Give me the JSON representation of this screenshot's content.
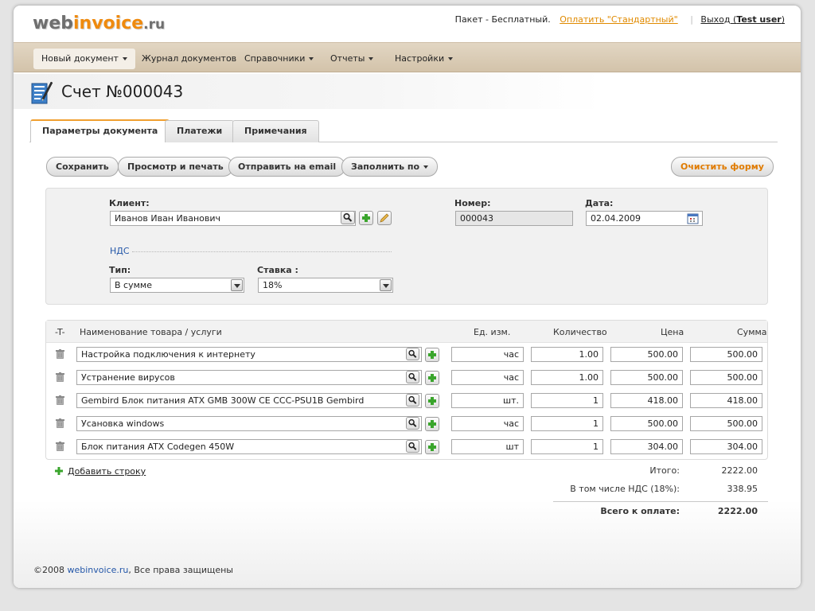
{
  "header": {
    "logo": {
      "part1": "web",
      "part2": "invoice",
      "part3": ".ru"
    },
    "plan_text": "Пакет - Бесплатный.",
    "upgrade_link": "Оплатить \"Стандартный\"",
    "logout_label": "Выход",
    "user_name": "Test user"
  },
  "menu": {
    "items": [
      {
        "label": "Новый документ"
      },
      {
        "label": "Журнал документов"
      },
      {
        "label": "Справочники"
      },
      {
        "label": "Отчеты"
      },
      {
        "label": "Настройки"
      }
    ]
  },
  "title": "Счет №000043",
  "tabs": [
    {
      "label": "Параметры документа"
    },
    {
      "label": "Платежи"
    },
    {
      "label": "Примечания"
    }
  ],
  "toolbar": {
    "save": "Сохранить",
    "preview": "Просмотр и печать",
    "email": "Отправить на email",
    "fill": "Заполнить по",
    "clear": "Очистить форму"
  },
  "form": {
    "client_label": "Клиент:",
    "client_value": "Иванов Иван Иванович",
    "number_label": "Номер:",
    "number_value": "000043",
    "date_label": "Дата:",
    "date_value": "02.04.2009",
    "nds_link": "НДС",
    "type_label": "Тип:",
    "type_value": "В сумме",
    "rate_label": "Ставка :",
    "rate_value": "18%"
  },
  "table": {
    "headers": {
      "t": "-T-",
      "name": "Наименование товара / услуги",
      "unit": "Ед. изм.",
      "qty": "Количество",
      "price": "Цена",
      "sum": "Сумма"
    },
    "rows": [
      {
        "name": "Настройка подключения к интернету",
        "unit": "час",
        "qty": "1.00",
        "price": "500.00",
        "sum": "500.00"
      },
      {
        "name": "Устранение вирусов",
        "unit": "час",
        "qty": "1.00",
        "price": "500.00",
        "sum": "500.00"
      },
      {
        "name": "Gembird Блок питания ATX GMB 300W CE CCC-PSU1B Gembird",
        "unit": "шт.",
        "qty": "1",
        "price": "418.00",
        "sum": "418.00"
      },
      {
        "name": "Усановка windows",
        "unit": "час",
        "qty": "1",
        "price": "500.00",
        "sum": "500.00"
      },
      {
        "name": "Блок питания ATX Codegen 450W",
        "unit": "шт",
        "qty": "1",
        "price": "304.00",
        "sum": "304.00"
      }
    ],
    "add_row": "Добавить строку"
  },
  "totals": {
    "subtotal_label": "Итого:",
    "subtotal_value": "2222.00",
    "vat_label": "В том числе НДС (18%):",
    "vat_value": "338.95",
    "total_label": "Всего к оплате:",
    "total_value": "2222.00"
  },
  "footer": {
    "copyright": "©2008",
    "site": "webinvoice.ru",
    "rights": ", Все права защищены"
  },
  "colors": {
    "accent_orange": "#ef8a0e",
    "link_blue": "#2356a8",
    "menu_bar": "#d9cbb5"
  },
  "icons": [
    "document-edit-icon",
    "search-icon",
    "add-icon",
    "edit-icon",
    "calendar-icon",
    "trash-icon",
    "dropdown-arrow-icon"
  ]
}
